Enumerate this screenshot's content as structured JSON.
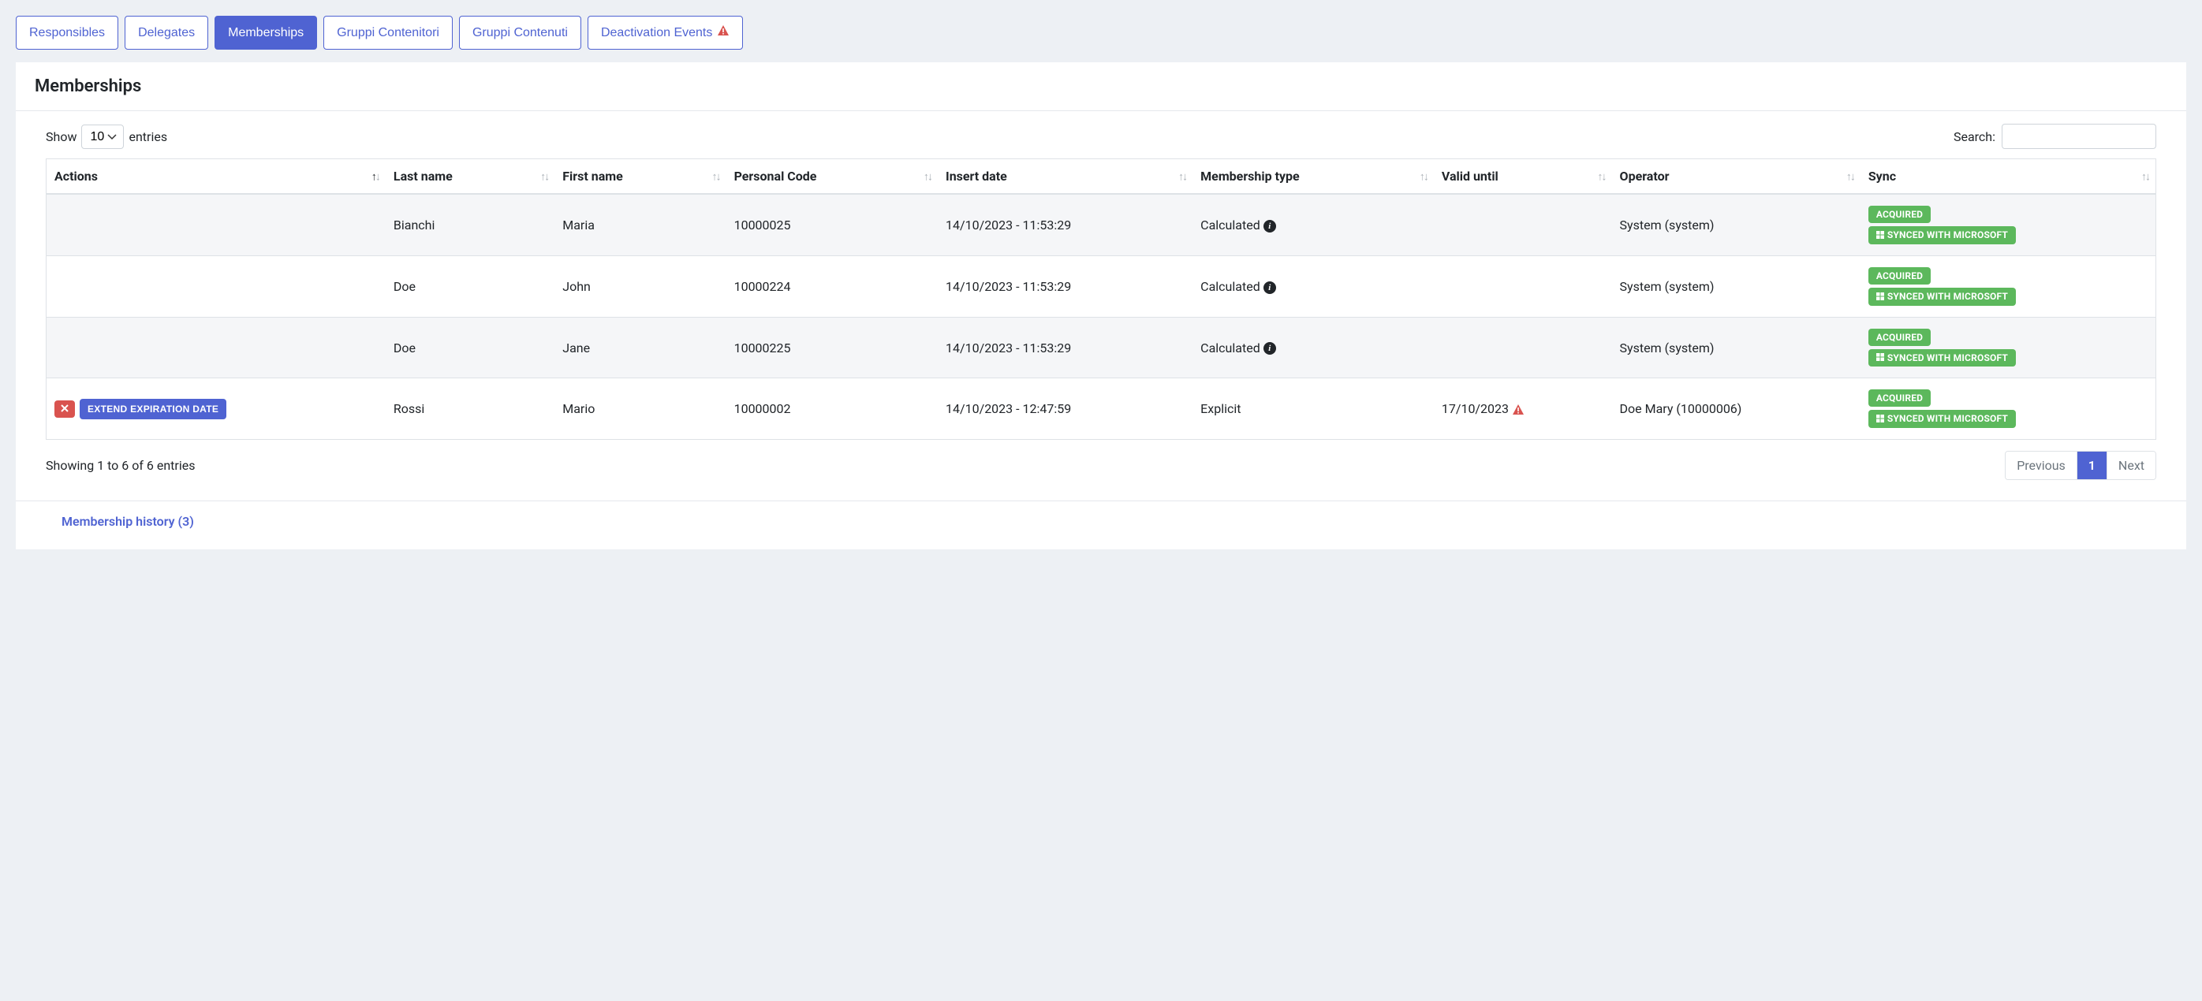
{
  "tabs": [
    {
      "label": "Responsibles",
      "active": false,
      "warning": false
    },
    {
      "label": "Delegates",
      "active": false,
      "warning": false
    },
    {
      "label": "Memberships",
      "active": true,
      "warning": false
    },
    {
      "label": "Gruppi Contenitori",
      "active": false,
      "warning": false
    },
    {
      "label": "Gruppi Contenuti",
      "active": false,
      "warning": false
    },
    {
      "label": "Deactivation Events",
      "active": false,
      "warning": true
    }
  ],
  "title": "Memberships",
  "length": {
    "pre": "Show",
    "value": "10",
    "post": "entries"
  },
  "search": {
    "label": "Search:",
    "value": ""
  },
  "columns": {
    "actions": "Actions",
    "last_name": "Last name",
    "first_name": "First name",
    "personal_code": "Personal Code",
    "insert_date": "Insert date",
    "membership_type": "Membership type",
    "valid_until": "Valid until",
    "operator": "Operator",
    "sync": "Sync"
  },
  "action_labels": {
    "extend": "EXTEND EXPIRATION DATE"
  },
  "badges": {
    "acquired": "ACQUIRED",
    "synced": "SYNCED WITH MICROSOFT"
  },
  "rows": [
    {
      "actions": null,
      "last_name": "Bianchi",
      "first_name": "Maria",
      "personal_code": "10000025",
      "insert_date": "14/10/2023 - 11:53:29",
      "membership_type": "Calculated",
      "membership_info": true,
      "valid_until": "",
      "valid_warn": false,
      "operator": "System (system)"
    },
    {
      "actions": null,
      "last_name": "Doe",
      "first_name": "John",
      "personal_code": "10000224",
      "insert_date": "14/10/2023 - 11:53:29",
      "membership_type": "Calculated",
      "membership_info": true,
      "valid_until": "",
      "valid_warn": false,
      "operator": "System (system)"
    },
    {
      "actions": null,
      "last_name": "Doe",
      "first_name": "Jane",
      "personal_code": "10000225",
      "insert_date": "14/10/2023 - 11:53:29",
      "membership_type": "Calculated",
      "membership_info": true,
      "valid_until": "",
      "valid_warn": false,
      "operator": "System (system)"
    },
    {
      "actions": "extend",
      "last_name": "Rossi",
      "first_name": "Mario",
      "personal_code": "10000002",
      "insert_date": "14/10/2023 - 12:47:59",
      "membership_type": "Explicit",
      "membership_info": false,
      "valid_until": "17/10/2023",
      "valid_warn": true,
      "operator": "Doe Mary (10000006)"
    }
  ],
  "info_text": "Showing 1 to 6 of 6 entries",
  "pagination": {
    "previous": "Previous",
    "next": "Next",
    "pages": [
      "1"
    ],
    "active": "1"
  },
  "history_link": "Membership history (3)"
}
